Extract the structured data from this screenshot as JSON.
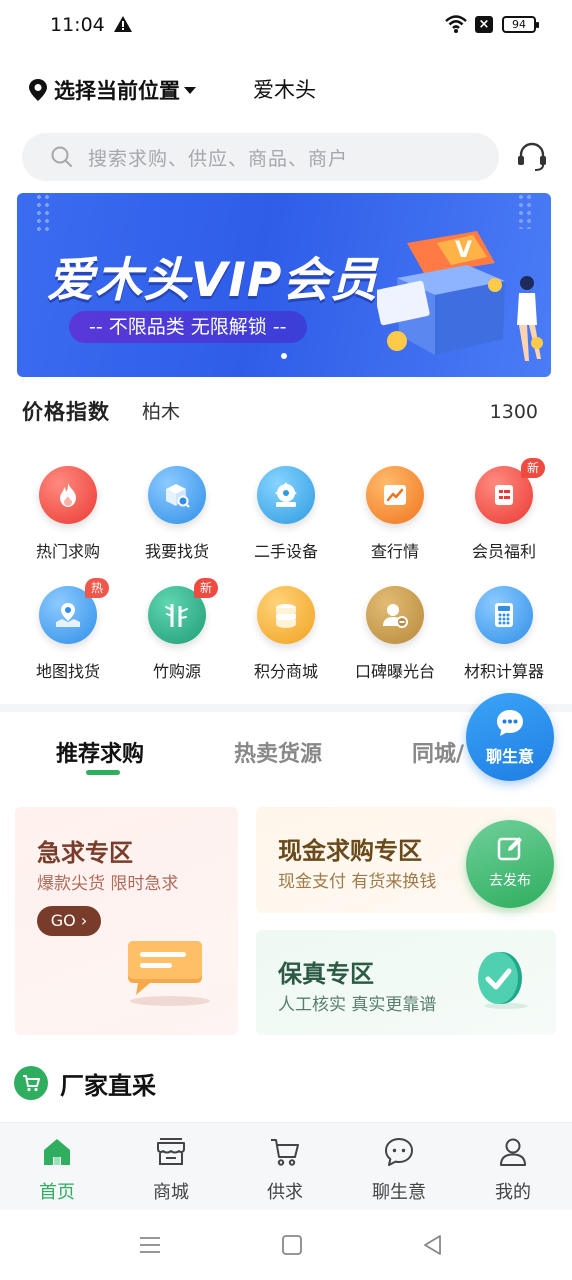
{
  "status_bar": {
    "time": "11:04",
    "battery": "94"
  },
  "header": {
    "location_label": "选择当前位置",
    "brand": "爱木头"
  },
  "search": {
    "placeholder": "搜索求购、供应、商品、商户"
  },
  "banner": {
    "title": "爱木头VIP会员",
    "subtitle": "-- 不限品类 无限解锁 --"
  },
  "price_index": {
    "title": "价格指数",
    "wood": "柏木",
    "value": "1300"
  },
  "grid": {
    "items": [
      {
        "label": "热门求购",
        "icon": "flame-icon",
        "color": "#f0473e"
      },
      {
        "label": "我要找货",
        "icon": "box-search-icon",
        "color": "#3d9cf0"
      },
      {
        "label": "二手设备",
        "icon": "saw-blade-icon",
        "color": "#3ba4e8"
      },
      {
        "label": "查行情",
        "icon": "trend-chart-icon",
        "color": "#f48a2a"
      },
      {
        "label": "会员福利",
        "icon": "member-card-icon",
        "color": "#f0473e",
        "tag": "新"
      },
      {
        "label": "地图找货",
        "icon": "map-pin-icon",
        "color": "#3d9cf0",
        "tag": "热"
      },
      {
        "label": "竹购源",
        "icon": "bamboo-icon",
        "color": "#2fae85",
        "tag": "新"
      },
      {
        "label": "积分商城",
        "icon": "coin-stack-icon",
        "color": "#f2a92a"
      },
      {
        "label": "口碑曝光台",
        "icon": "user-badge-icon",
        "color": "#c79a4a"
      },
      {
        "label": "材积计算器",
        "icon": "calculator-icon",
        "color": "#3d9cf0"
      }
    ]
  },
  "tabs": [
    {
      "label": "推荐求购",
      "active": true
    },
    {
      "label": "热卖货源",
      "active": false
    },
    {
      "label": "同城/",
      "active": false
    }
  ],
  "cards": {
    "urgent": {
      "title": "急求专区",
      "subtitle": "爆款尖货 限时急求",
      "go": "GO ›"
    },
    "cash": {
      "title": "现金求购专区",
      "subtitle": "现金支付 有货来换钱"
    },
    "genuine": {
      "title": "保真专区",
      "subtitle": "人工核实 真实更靠谱"
    }
  },
  "floating": {
    "chat": "聊生意",
    "post": "去发布"
  },
  "section": {
    "title": "厂家直采"
  },
  "bottom_nav": [
    {
      "label": "首页",
      "icon": "home-icon",
      "active": true
    },
    {
      "label": "商城",
      "icon": "store-icon",
      "active": false
    },
    {
      "label": "供求",
      "icon": "cart-icon",
      "active": false
    },
    {
      "label": "聊生意",
      "icon": "chat-bubble-icon",
      "active": false
    },
    {
      "label": "我的",
      "icon": "user-icon",
      "active": false
    }
  ],
  "colors": {
    "primary_green": "#2fae5f",
    "chat_blue": "#1f7ee4",
    "banner_blue": "#2f5de8"
  }
}
